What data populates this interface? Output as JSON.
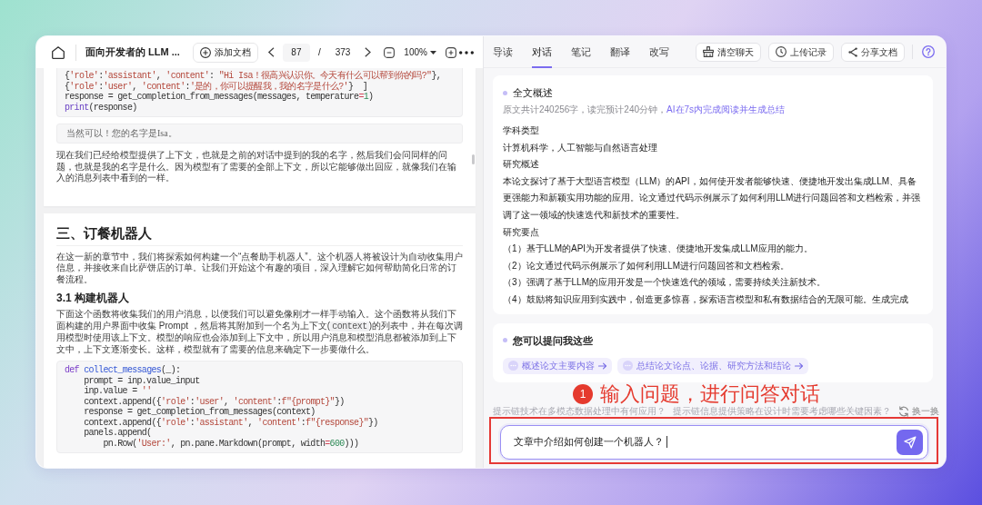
{
  "doc_toolbar": {
    "title": "面向开发者的 LLM ...",
    "add_document": "添加文档",
    "page": "87",
    "page_separator": "/",
    "page_total": "373",
    "zoom": "100%"
  },
  "document": {
    "pages": [
      {
        "blocks": [
          {
            "kind": "code",
            "lines": [
              [
                {
                  "kind": "plain",
                  "text": "{"
                },
                {
                  "kind": "string",
                  "text": "'role'"
                },
                {
                  "kind": "plain",
                  "text": ":"
                },
                {
                  "kind": "string",
                  "text": "'assistant'"
                },
                {
                  "kind": "plain",
                  "text": ", "
                },
                {
                  "kind": "string",
                  "text": "'content'"
                },
                {
                  "kind": "plain",
                  "text": ": "
                },
                {
                  "kind": "string",
                  "text": "\"Hi Isa！很高兴认识你。今天有什么可以帮到你的吗?\""
                },
                {
                  "kind": "plain",
                  "text": "},"
                }
              ],
              [
                {
                  "kind": "plain",
                  "text": "{"
                },
                {
                  "kind": "string",
                  "text": "'role'"
                },
                {
                  "kind": "plain",
                  "text": ":"
                },
                {
                  "kind": "string",
                  "text": "'user'"
                },
                {
                  "kind": "plain",
                  "text": ", "
                },
                {
                  "kind": "string",
                  "text": "'content'"
                },
                {
                  "kind": "plain",
                  "text": ":"
                },
                {
                  "kind": "string",
                  "text": "'是的，你可以提醒我，我的名字是什么?'"
                },
                {
                  "kind": "plain",
                  "text": "}  ]"
                }
              ],
              [
                {
                  "kind": "plain",
                  "text": "response = get_completion_from_messages(messages, temperature"
                },
                {
                  "kind": "operator",
                  "text": "="
                },
                {
                  "kind": "number",
                  "text": "1"
                },
                {
                  "kind": "plain",
                  "text": ")"
                }
              ],
              [
                {
                  "kind": "builtin",
                  "text": "print"
                },
                {
                  "kind": "plain",
                  "text": "(response)"
                }
              ]
            ]
          },
          {
            "kind": "output",
            "text": "当然可以！您的名字是Isa。"
          },
          {
            "kind": "paragraph",
            "segments": [
              {
                "kind": "text",
                "text": "现在我们已经给模型提供了上下文，也就是之前的对话中提到的我的名字，然后我们会问同样的问题，也就是我的名字是什么。因为模型有了需要的全部上下文，所以它能够做出回应，就像我们在输入的消息列表中看到的一样。"
              }
            ]
          }
        ]
      },
      {
        "blocks": [
          {
            "kind": "heading",
            "text": "三、订餐机器人"
          },
          {
            "kind": "paragraph",
            "segments": [
              {
                "kind": "text",
                "text": "在这一新的章节中，我们将探索如何构建一个“点餐助手机器人”。这个机器人将被设计为自动收集用户信息，并接收来自比萨饼店的订单。让我们开始这个有趣的项目，深入理解它如何帮助简化日常的订餐流程。"
              }
            ]
          },
          {
            "kind": "subheading",
            "text": "3.1 构建机器人"
          },
          {
            "kind": "paragraph",
            "segments": [
              {
                "kind": "text",
                "text": "下面这个函数将收集我们的用户消息，以便我们可以避免像刚才一样手动输入。这个函数将从我们下面构建的用户界面中收集 Prompt ，然后将其附加到一个名为上下文("
              },
              {
                "kind": "code",
                "text": "context"
              },
              {
                "kind": "text",
                "text": ")的列表中，并在每次调用模型时使用该上下文。模型的响应也会添加到上下文中，所以用户消息和模型消息都被添加到上下文中，上下文逐渐变长。这样，模型就有了需要的信息来确定下一步要做什么。"
              }
            ]
          },
          {
            "kind": "code",
            "lines": [
              [
                {
                  "kind": "keyword",
                  "text": "def "
                },
                {
                  "kind": "function",
                  "text": "collect_messages"
                },
                {
                  "kind": "plain",
                  "text": "(_):"
                }
              ],
              [
                {
                  "kind": "plain",
                  "text": "    prompt = inp.value_input"
                }
              ],
              [
                {
                  "kind": "plain",
                  "text": "    inp.value = "
                },
                {
                  "kind": "string",
                  "text": "''"
                }
              ],
              [
                {
                  "kind": "plain",
                  "text": "    context.append({"
                },
                {
                  "kind": "string",
                  "text": "'role'"
                },
                {
                  "kind": "plain",
                  "text": ":"
                },
                {
                  "kind": "string",
                  "text": "'user'"
                },
                {
                  "kind": "plain",
                  "text": ", "
                },
                {
                  "kind": "string",
                  "text": "'content'"
                },
                {
                  "kind": "plain",
                  "text": ":"
                },
                {
                  "kind": "string",
                  "text": "f\"{prompt}\""
                },
                {
                  "kind": "plain",
                  "text": "})"
                }
              ],
              [
                {
                  "kind": "plain",
                  "text": "    response = get_completion_from_messages(context)"
                }
              ],
              [
                {
                  "kind": "plain",
                  "text": "    context.append({"
                },
                {
                  "kind": "string",
                  "text": "'role'"
                },
                {
                  "kind": "plain",
                  "text": ":"
                },
                {
                  "kind": "string",
                  "text": "'assistant'"
                },
                {
                  "kind": "plain",
                  "text": ", "
                },
                {
                  "kind": "string",
                  "text": "'content'"
                },
                {
                  "kind": "plain",
                  "text": ":"
                },
                {
                  "kind": "string",
                  "text": "f\"{response}\""
                },
                {
                  "kind": "plain",
                  "text": "})"
                }
              ],
              [
                {
                  "kind": "plain",
                  "text": "    panels.append("
                }
              ],
              [
                {
                  "kind": "plain",
                  "text": "        pn.Row("
                },
                {
                  "kind": "string",
                  "text": "'User:'"
                },
                {
                  "kind": "plain",
                  "text": ", pn.pane.Markdown(prompt, width"
                },
                {
                  "kind": "operator",
                  "text": "="
                },
                {
                  "kind": "number",
                  "text": "600"
                },
                {
                  "kind": "plain",
                  "text": ")))"
                }
              ]
            ]
          }
        ]
      }
    ]
  },
  "chat_tabs": [
    {
      "label": "导读",
      "selected": false
    },
    {
      "label": "对话",
      "selected": true
    },
    {
      "label": "笔记",
      "selected": false
    },
    {
      "label": "翻译",
      "selected": false
    },
    {
      "label": "改写",
      "selected": false
    }
  ],
  "chat_actions": [
    {
      "kind": "clear",
      "label": "清空聊天"
    },
    {
      "kind": "history",
      "label": "上传记录"
    },
    {
      "kind": "share",
      "label": "分享文档"
    }
  ],
  "summary": {
    "title": "全文概述",
    "stats": "原文共计240256字，读完预计240分钟，",
    "ai_note": "AI在7s内完成阅读并生成总结",
    "lines": [
      "学科类型",
      "计算机科学，人工智能与自然语言处理",
      "研究概述",
      "本论文探讨了基于大型语言模型（LLM）的API，如何使开发者能够快速、便捷地开发出集成LLM、具备更强能力和新颖实用功能的应用。论文通过代码示例展示了如何利用LLM进行问题回答和文档检索，并强调了这一领域的快速迭代和新技术的重要性。",
      "研究要点",
      "（1）基于LLM的API为开发者提供了快速、便捷地开发集成LLM应用的能力。",
      "（2）论文通过代码示例展示了如何利用LLM进行问题回答和文档检索。",
      "（3）强调了基于LLM的应用开发是一个快速迭代的领域，需要持续关注新技术。",
      "（4）鼓励将知识应用到实践中，创造更多惊喜，探索语言模型和私有数据结合的无限可能。生成完成"
    ]
  },
  "prompts": {
    "title": "您可以提问我这些",
    "chips": [
      "概述论文主要内容",
      "总结论文论点、论据、研究方法和结论"
    ]
  },
  "annotation": {
    "badge": "1",
    "text": "输入问题，进行问答对话"
  },
  "suggestions": {
    "items": [
      "提示链技术在多模态数据处理中有何应用？",
      "提示链信息提供策略在设计时需要考虑哪些关键因素？"
    ],
    "refresh": "换一换"
  },
  "question_input": {
    "value": "文章中介绍如何创建一个机器人？"
  }
}
